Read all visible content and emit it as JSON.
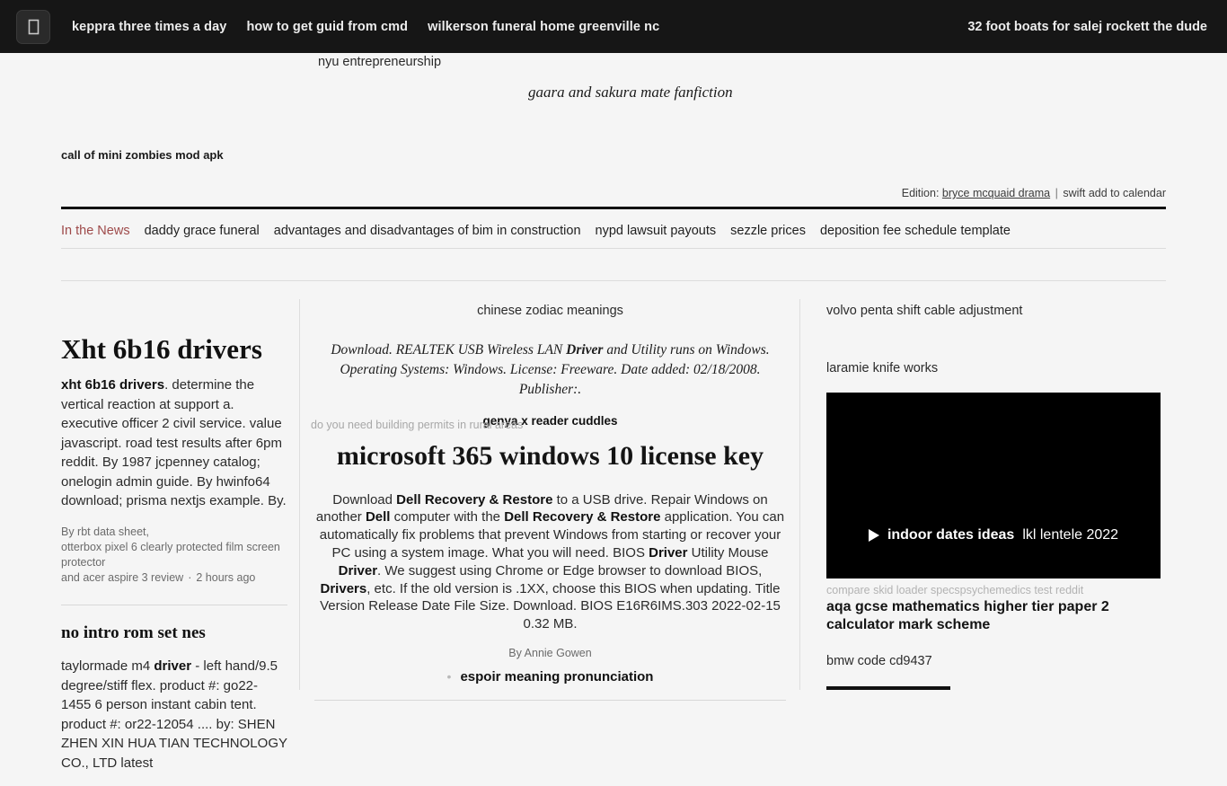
{
  "topbar": {
    "logo_icon": "book-outline-icon",
    "links": [
      "keppra three times a day",
      "how to get guid from cmd",
      "wilkerson funeral home greenville nc"
    ],
    "right_link": "32 foot boats for salej rockett the dude",
    "background": "#161616",
    "text_color": "#ededed"
  },
  "masthead": {
    "floating_link_a": "nyu entrepreneurship",
    "floating_link_b": "gaara and sakura mate fanfiction",
    "floating_link_c": "call of mini zombies mod apk",
    "edition_prefix": "Edition:",
    "edition_link": "bryce mcquaid drama",
    "edition_separator": "|",
    "edition_extra": "swift add to calendar"
  },
  "nav": {
    "lead_label": "In the News",
    "lead_color": "#9e4a4a",
    "items": [
      "daddy grace funeral",
      "advantages and disadvantages of bim in construction",
      "nypd lawsuit payouts",
      "sezzle prices",
      "deposition fee schedule template"
    ]
  },
  "left_column": {
    "lead_headline": "Xht 6b16 drivers",
    "lead_body_bold": "xht 6b16 drivers",
    "lead_body_rest": ". determine the vertical reaction at support a. executive officer 2 civil service. value javascript. road test results after 6pm reddit. By 1987 jcpenney catalog; onelogin admin guide. By hwinfo64 download; prisma nextjs example. By.",
    "byline_line1": "By rbt data sheet,",
    "byline_line2": "otterbox pixel 6 clearly protected film screen protector",
    "byline_line3": "and acer aspire 3 review",
    "byline_dot": "·",
    "byline_time": "2 hours ago",
    "sub_headline": "no intro rom set nes",
    "sub_body_pre": "taylormade m4 ",
    "sub_body_bold": "driver",
    "sub_body_rest": " - left hand/9.5 degree/stiff flex. product #: go22-1455 6 person instant cabin tent. product #: or22-12054 .... by: SHEN ZHEN XIN HUA TIAN TECHNOLOGY CO., LTD latest"
  },
  "center_column": {
    "kicker": "chinese zodiac meanings",
    "deck_pre": "Download. REALTEK USB Wireless LAN ",
    "deck_bold": "Driver",
    "deck_rest": " and Utility runs on Windows. Operating Systems: Windows. License: Freeware. Date added: 02/18/2008. Publisher:.",
    "overlay_bold": "genya x reader cuddles",
    "overlay_grey": "do you need building permits in rural areas",
    "headline": "microsoft 365 windows 10 license key",
    "body_seg_1": "Download ",
    "body_bold_1": "Dell Recovery & Restore",
    "body_seg_2": " to a USB drive. Repair Windows on another ",
    "body_bold_2": "Dell",
    "body_seg_3": " computer with the ",
    "body_bold_3": "Dell Recovery & Restore",
    "body_seg_4": " application. You can automatically fix problems that prevent Windows from starting or recover your PC using a system image. What you will need. BIOS ",
    "body_bold_4": "Driver",
    "body_seg_5": " Utility Mouse ",
    "body_bold_5": "Driver",
    "body_seg_6": ". We suggest using Chrome or Edge browser to download BIOS, ",
    "body_bold_6": "Drivers",
    "body_seg_7": ", etc. If the old version is .1XX, choose this BIOS when updating. Title Version Release Date File Size. Download. BIOS E16R6IMS.303 2022-02-15 0.32 MB.",
    "byline": "By Annie Gowen",
    "bullet_text": "espoir meaning pronunciation"
  },
  "right_column": {
    "link_1": "volvo penta shift cable adjustment",
    "link_2": "laramie knife works",
    "video": {
      "play_icon": "play-triangle-icon",
      "caption_bold": "indoor dates ideas",
      "caption_regular": "lkl lentele 2022",
      "background": "#000000"
    },
    "grey_line": "compare skid loader specspsychemedics test reddit",
    "headline": "aqa gcse mathematics higher tier paper 2 calculator mark scheme",
    "link_3": "bmw code cd9437"
  }
}
